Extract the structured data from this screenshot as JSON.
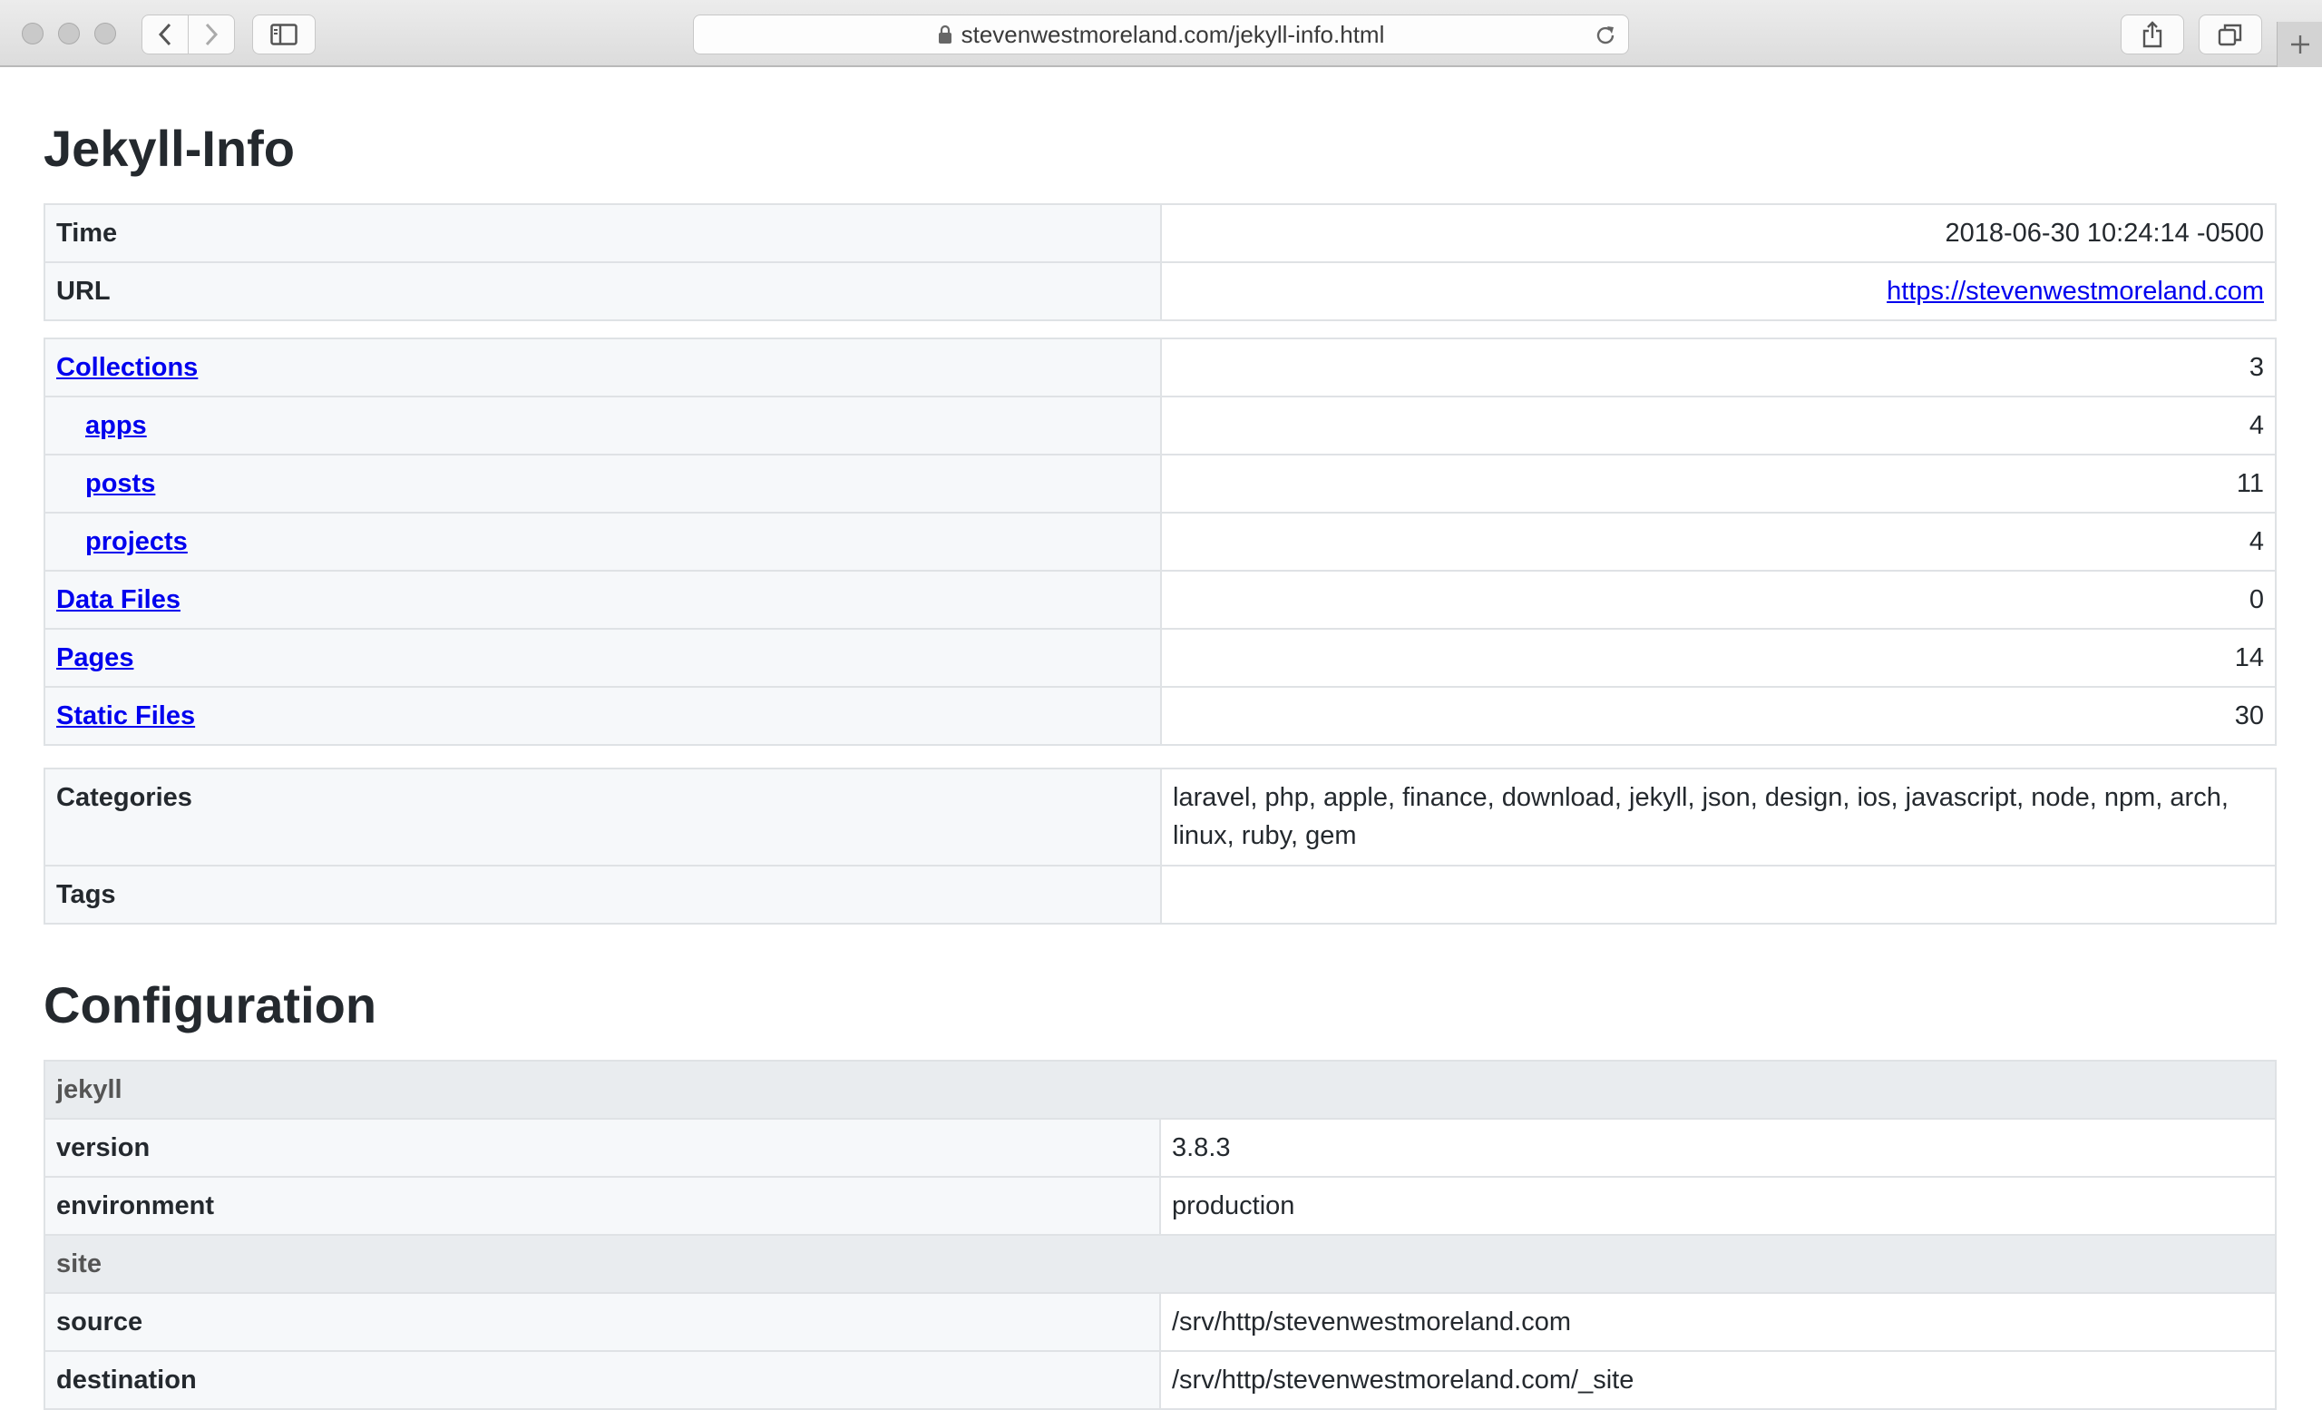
{
  "browser": {
    "url": "stevenwestmoreland.com/jekyll-info.html"
  },
  "headings": {
    "info": "Jekyll-Info",
    "config": "Configuration"
  },
  "info_table": {
    "time_label": "Time",
    "time_value": "2018-06-30 10:24:14 -0500",
    "url_label": "URL",
    "url_value": "https://stevenwestmoreland.com"
  },
  "counts_table": {
    "collections_label": "Collections",
    "collections_value": "3",
    "apps_label": "apps",
    "apps_value": "4",
    "posts_label": "posts",
    "posts_value": "11",
    "projects_label": "projects",
    "projects_value": "4",
    "data_files_label": "Data Files",
    "data_files_value": "0",
    "pages_label": "Pages",
    "pages_value": "14",
    "static_files_label": "Static Files",
    "static_files_value": "30"
  },
  "taxonomy_table": {
    "categories_label": "Categories",
    "categories_value": "laravel, php, apple, finance, download, jekyll, json, design, ios, javascript, node, npm, arch, linux, ruby, gem",
    "tags_label": "Tags",
    "tags_value": ""
  },
  "config_table": {
    "jekyll_section": "jekyll",
    "version_label": "version",
    "version_value": "3.8.3",
    "environment_label": "environment",
    "environment_value": "production",
    "site_section": "site",
    "source_label": "source",
    "source_value": "/srv/http/stevenwestmoreland.com",
    "destination_label": "destination",
    "destination_value": "/srv/http/stevenwestmoreland.com/_site"
  }
}
